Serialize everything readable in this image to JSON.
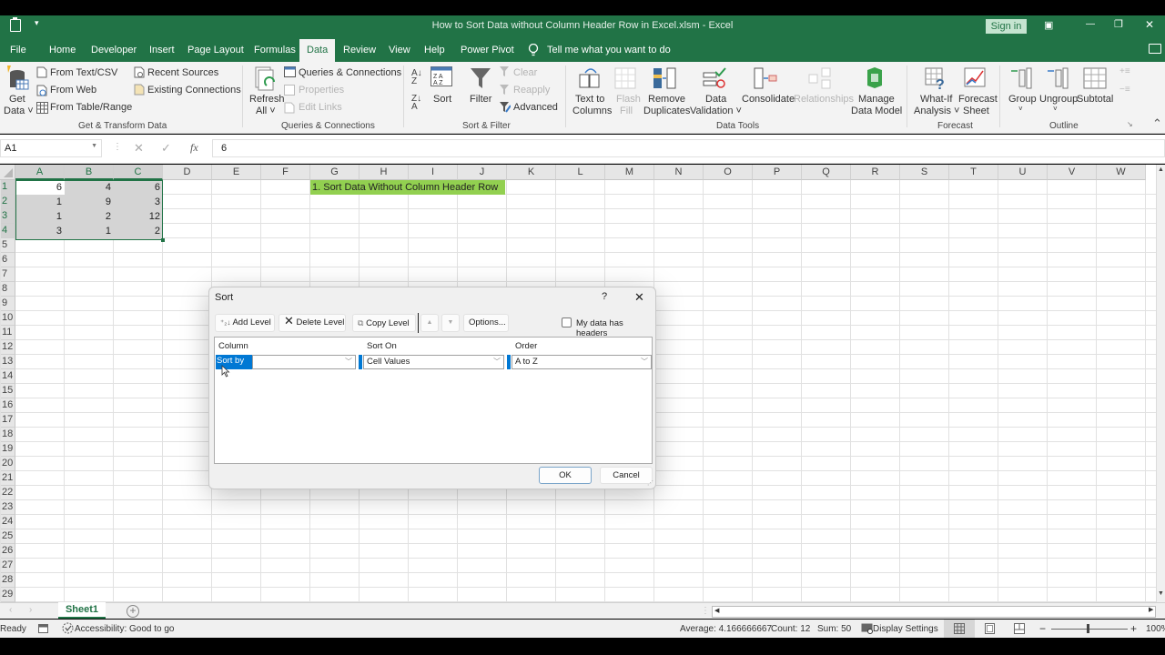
{
  "titlebar": {
    "title": "How to Sort Data without Column Header Row in Excel.xlsm  -  Excel",
    "sign_in": "Sign in",
    "qat_caret": "▾",
    "ribbon_display_icon": "▣",
    "minimize": "—",
    "restore": "❐",
    "close": "✕"
  },
  "tabs": [
    {
      "label": "File"
    },
    {
      "label": "Home"
    },
    {
      "label": "Developer"
    },
    {
      "label": "Insert"
    },
    {
      "label": "Page Layout"
    },
    {
      "label": "Formulas"
    },
    {
      "label": "Data",
      "active": true
    },
    {
      "label": "Review"
    },
    {
      "label": "View"
    },
    {
      "label": "Help"
    },
    {
      "label": "Power Pivot"
    }
  ],
  "tell_me": "Tell me what you want to do",
  "ribbon": {
    "get_data": {
      "line1": "Get",
      "line2": "Data ˅"
    },
    "from_text_csv": "From Text/CSV",
    "from_web": "From Web",
    "from_table_range": "From Table/Range",
    "recent_sources": "Recent Sources",
    "existing_connections": "Existing Connections",
    "group_get_transform": "Get & Transform Data",
    "refresh_all": {
      "line1": "Refresh",
      "line2": "All ˅"
    },
    "queries_connections": "Queries & Connections",
    "properties": "Properties",
    "edit_links": "Edit Links",
    "group_queries": "Queries & Connections",
    "sort": "Sort",
    "filter": "Filter",
    "clear": "Clear",
    "reapply": "Reapply",
    "advanced": "Advanced",
    "group_sort_filter": "Sort & Filter",
    "text_to_columns": {
      "line1": "Text to",
      "line2": "Columns"
    },
    "flash_fill": {
      "line1": "Flash",
      "line2": "Fill"
    },
    "remove_duplicates": {
      "line1": "Remove",
      "line2": "Duplicates"
    },
    "data_validation": {
      "line1": "Data",
      "line2": "Validation ˅"
    },
    "consolidate": "Consolidate",
    "relationships": "Relationships",
    "manage_data_model": {
      "line1": "Manage",
      "line2": "Data Model"
    },
    "group_data_tools": "Data Tools",
    "what_if": {
      "line1": "What-If",
      "line2": "Analysis ˅"
    },
    "forecast_sheet": {
      "line1": "Forecast",
      "line2": "Sheet"
    },
    "group_forecast": "Forecast",
    "group": {
      "line1": "Group",
      "line2": "˅"
    },
    "ungroup": {
      "line1": "Ungroup",
      "line2": "˅"
    },
    "subtotal": "Subtotal",
    "group_outline": "Outline",
    "collapse": "⌃"
  },
  "formula_bar": {
    "name_box": "A1",
    "cancel": "✕",
    "enter": "✓",
    "fx": "fx",
    "value": "6"
  },
  "sheet": {
    "columns": [
      "A",
      "B",
      "C",
      "D",
      "E",
      "F",
      "G",
      "H",
      "I",
      "J",
      "K",
      "L",
      "M",
      "N",
      "O",
      "P",
      "Q",
      "R",
      "S",
      "T",
      "U",
      "V",
      "W"
    ],
    "rows": [
      "1",
      "2",
      "3",
      "4",
      "5",
      "6",
      "7",
      "8",
      "9",
      "10",
      "11",
      "12",
      "13",
      "14",
      "15",
      "16",
      "17",
      "18",
      "19",
      "20",
      "21",
      "22",
      "23",
      "24",
      "25",
      "26",
      "27",
      "28",
      "29"
    ],
    "cells": [
      [
        "6",
        "4",
        "6"
      ],
      [
        "1",
        "9",
        "3"
      ],
      [
        "1",
        "2",
        "12"
      ],
      [
        "3",
        "1",
        "2"
      ]
    ],
    "note": "1. Sort Data Without Column Header Row",
    "note_color": "#92d050",
    "selection": "A1:C4",
    "active_cell": "A1"
  },
  "sort_dialog": {
    "title": "Sort",
    "help": "?",
    "close": "✕",
    "add_level": "Add Level",
    "delete_level": "Delete Level",
    "copy_level": "Copy Level",
    "move_up": "▲",
    "move_down": "▼",
    "options": "Options...",
    "my_data_has_headers": "My data has headers",
    "headers_checked": false,
    "col_header": "Column",
    "sort_on_header": "Sort On",
    "order_header": "Order",
    "sort_by_label": "Sort by",
    "column_value": "",
    "sort_on_value": "Cell Values",
    "order_value": "A to Z",
    "ok": "OK",
    "cancel": "Cancel"
  },
  "sheet_tabs": {
    "active": "Sheet1",
    "add": "+"
  },
  "status": {
    "ready": "Ready",
    "accessibility": "Accessibility: Good to go",
    "average": "Average: 4.166666667",
    "count": "Count: 12",
    "sum": "Sum: 50",
    "display_settings": "Display Settings",
    "zoom": "100%",
    "zoom_out": "−",
    "zoom_in": "+"
  },
  "colors": {
    "excel_green": "#217346",
    "selection_fill": "#d4d4d4",
    "dialog_highlight": "#0078d4"
  }
}
